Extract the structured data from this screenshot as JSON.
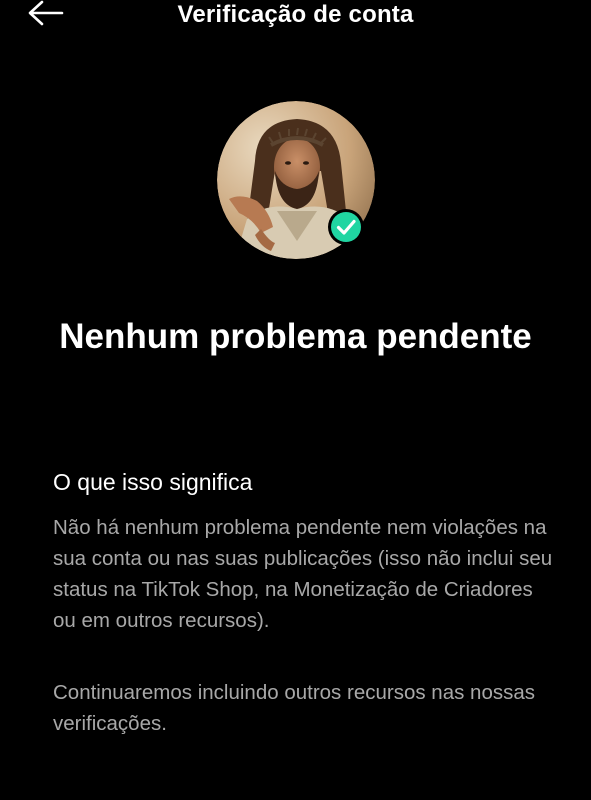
{
  "header": {
    "title": "Verificação de conta",
    "back_icon": "arrow-left-icon"
  },
  "profile": {
    "badge_icon": "check-circle-icon",
    "badge_color": "#20d5a2"
  },
  "status": {
    "title": "Nenhum problema pendente"
  },
  "details": {
    "heading": "O que isso significa",
    "paragraph_1": "Não há nenhum problema pendente nem violações na sua conta ou nas suas publicações (isso não inclui seu status na TikTok Shop, na Monetização de Criadores ou em outros recursos).",
    "paragraph_2": "Continuaremos incluindo outros recursos nas nossas verificações."
  },
  "colors": {
    "background": "#000000",
    "text_primary": "#ffffff",
    "text_secondary": "#a8a8a8",
    "accent": "#20d5a2"
  }
}
